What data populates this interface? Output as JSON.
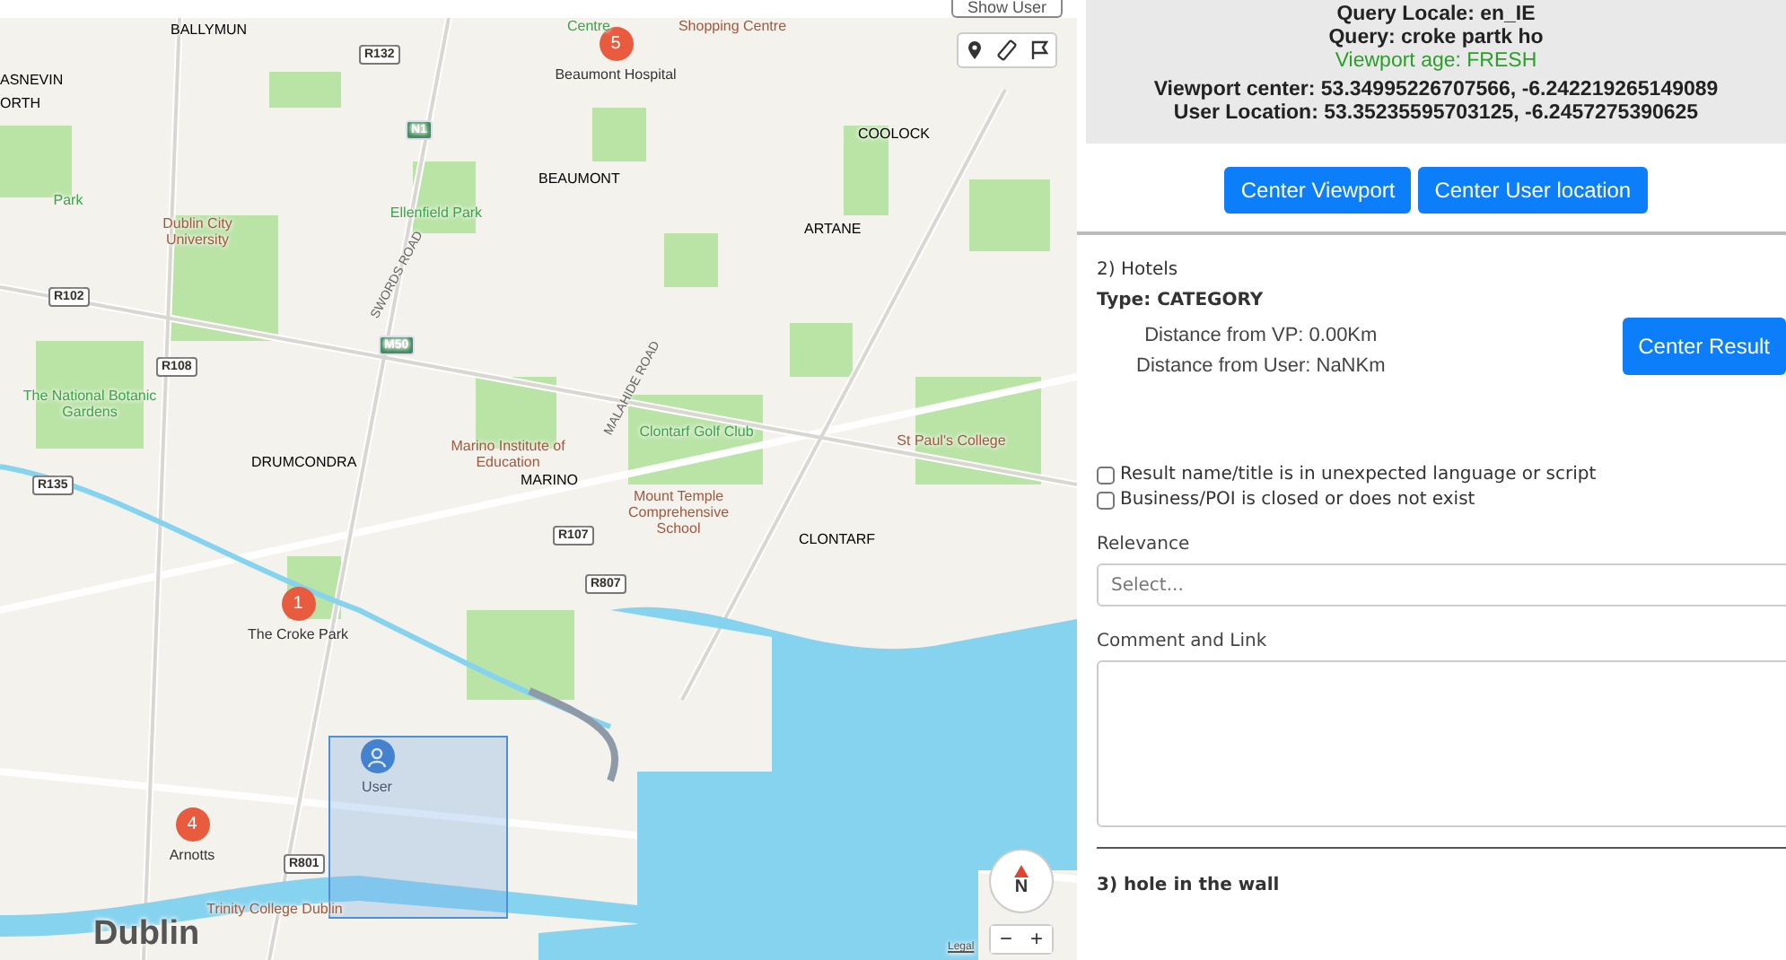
{
  "map": {
    "show_user_button": "Show User",
    "labels": [
      {
        "text": "BALLYMUN",
        "kind": "district"
      },
      {
        "text": "ASNEVIN",
        "kind": "district"
      },
      {
        "text": "ORTH",
        "kind": "district"
      },
      {
        "text": "Centre",
        "kind": "park"
      },
      {
        "text": "Shopping Centre",
        "kind": "poi"
      },
      {
        "text": "BEAUMONT",
        "kind": "district"
      },
      {
        "text": "COOLOCK",
        "kind": "district"
      },
      {
        "text": "ARTANE",
        "kind": "district"
      },
      {
        "text": "Park",
        "kind": "park"
      },
      {
        "text": "Dublin City University",
        "kind": "poi"
      },
      {
        "text": "Ellenfield Park",
        "kind": "park"
      },
      {
        "text": "The National Botanic Gardens",
        "kind": "park"
      },
      {
        "text": "Marino Institute of Education",
        "kind": "poi"
      },
      {
        "text": "Clontarf Golf Club",
        "kind": "park"
      },
      {
        "text": "Mount Temple Comprehensive School",
        "kind": "poi"
      },
      {
        "text": "St Paul's College",
        "kind": "poi"
      },
      {
        "text": "DRUMCONDRA",
        "kind": "district"
      },
      {
        "text": "MARINO",
        "kind": "district"
      },
      {
        "text": "CLONTARF",
        "kind": "district"
      },
      {
        "text": "SWORDS ROAD",
        "kind": "street"
      },
      {
        "text": "MALAHIDE ROAD",
        "kind": "street"
      },
      {
        "text": "R132",
        "kind": "road"
      },
      {
        "text": "N1",
        "kind": "motorway"
      },
      {
        "text": "M50",
        "kind": "motorway"
      },
      {
        "text": "R102",
        "kind": "road"
      },
      {
        "text": "R108",
        "kind": "road"
      },
      {
        "text": "R135",
        "kind": "road"
      },
      {
        "text": "R107",
        "kind": "road"
      },
      {
        "text": "R807",
        "kind": "road"
      },
      {
        "text": "R801",
        "kind": "road"
      },
      {
        "text": "Trinity College Dublin",
        "kind": "poi"
      },
      {
        "text": "Dublin",
        "kind": "city"
      },
      {
        "text": "Legal",
        "kind": "legal"
      }
    ],
    "markers": [
      {
        "kind": "result",
        "number": "5",
        "label": "Beaumont Hospital"
      },
      {
        "kind": "result",
        "number": "1",
        "label": "The Croke Park"
      },
      {
        "kind": "result",
        "number": "4",
        "label": "Arnotts"
      },
      {
        "kind": "user",
        "label": "User"
      }
    ],
    "compass": "N",
    "zoom_buttons": [
      "−",
      "+"
    ]
  },
  "info": {
    "lines": [
      {
        "text": "Query Locale: en_IE",
        "kind": "plain"
      },
      {
        "text": "Query: croke partk ho",
        "kind": "plain"
      },
      {
        "text": "Viewport age: FRESH",
        "kind": "fresh"
      },
      {
        "text": "Viewport center: 53.34995226707566, -6.242219265149089",
        "kind": "coords"
      },
      {
        "text": "User Location: 53.35235595703125, -6.2457275390625",
        "kind": "plain"
      }
    ],
    "buttons": [
      "Center Viewport",
      "Center User location"
    ]
  },
  "results": [
    {
      "title": "2) Hotels",
      "type": "Type: CATEGORY",
      "distances": [
        "Distance from VP: 0.00Km",
        "Distance from User: NaNKm"
      ],
      "button": "Center Result",
      "checks": [
        {
          "label": "Result name/title is in unexpected language or script",
          "checked": false
        },
        {
          "label": "Business/POI is closed or does not exist",
          "checked": false
        }
      ],
      "relevance_label": "Relevance",
      "relevance": {
        "placeholder": "Select..."
      },
      "comment_label": "Comment and Link"
    }
  ],
  "next_result": {
    "title": "3) hole in the wall"
  }
}
